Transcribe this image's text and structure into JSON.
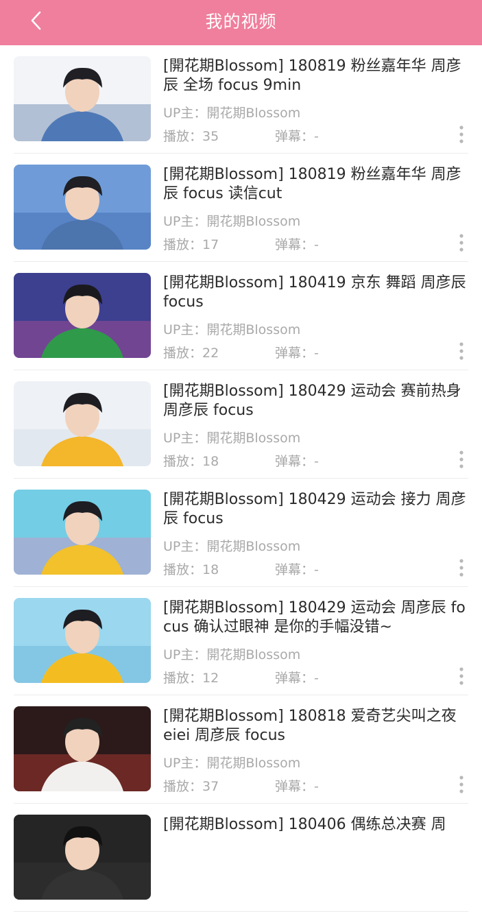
{
  "header": {
    "title": "我的视频",
    "back_icon": "chevron-left-icon",
    "background": "#ef7f9c"
  },
  "videos": [
    {
      "title": "[開花期Blossom] 180819 粉丝嘉年华 周彦辰 全场 focus 9min",
      "uploader": "UP主：開花期Blossom",
      "plays": "播放：35",
      "danmu": "弹幕：-"
    },
    {
      "title": "[開花期Blossom] 180819 粉丝嘉年华 周彦辰 focus 读信cut",
      "uploader": "UP主：開花期Blossom",
      "plays": "播放：17",
      "danmu": "弹幕：-"
    },
    {
      "title": "[開花期Blossom] 180419 京东 舞蹈 周彦辰 focus",
      "uploader": "UP主：開花期Blossom",
      "plays": "播放：22",
      "danmu": "弹幕：-"
    },
    {
      "title": "[開花期Blossom] 180429 运动会 赛前热身 周彦辰 focus",
      "uploader": "UP主：開花期Blossom",
      "plays": "播放：18",
      "danmu": "弹幕：-"
    },
    {
      "title": "[開花期Blossom] 180429 运动会 接力 周彦辰 focus",
      "uploader": "UP主：開花期Blossom",
      "plays": "播放：18",
      "danmu": "弹幕：-"
    },
    {
      "title": "[開花期Blossom] 180429 运动会 周彦辰 focus 确认过眼神 是你的手幅没错~",
      "uploader": "UP主：開花期Blossom",
      "plays": "播放：12",
      "danmu": "弹幕：-"
    },
    {
      "title": "[開花期Blossom] 180818 爱奇艺尖叫之夜 eiei 周彦辰 focus",
      "uploader": "UP主：開花期Blossom",
      "plays": "播放：37",
      "danmu": "弹幕：-"
    },
    {
      "title": "[開花期Blossom] 180406 偶练总决赛 周",
      "uploader": "",
      "plays": "",
      "danmu": ""
    }
  ],
  "thumbnails": [
    {
      "bg": "#f2f4f7",
      "accent": "#3c5f96",
      "hair": "#1f1f24",
      "shirt": "#4f79b6"
    },
    {
      "bg": "#6f9cd8",
      "accent": "#2e5aa6",
      "hair": "#1f1f24",
      "shirt": "#4c74ad"
    },
    {
      "bg": "#3d3f8f",
      "accent": "#d84f9a",
      "hair": "#1a1a1e",
      "shirt": "#2f9a4a"
    },
    {
      "bg": "#eef1f5",
      "accent": "#c9d6e6",
      "hair": "#1d1d22",
      "shirt": "#f4b62a"
    },
    {
      "bg": "#73cde4",
      "accent": "#f07fb8",
      "hair": "#1d1d22",
      "shirt": "#f2c12b"
    },
    {
      "bg": "#9bd7ee",
      "accent": "#5aa9d0",
      "hair": "#1d1d22",
      "shirt": "#f3bd22"
    },
    {
      "bg": "#2c1a1a",
      "accent": "#e2453b",
      "hair": "#222",
      "shirt": "#f2f0ee"
    },
    {
      "bg": "#252525",
      "accent": "#3a3a3a",
      "hair": "#111",
      "shirt": "#333"
    }
  ],
  "icons": {
    "more": "more-vertical-icon"
  }
}
